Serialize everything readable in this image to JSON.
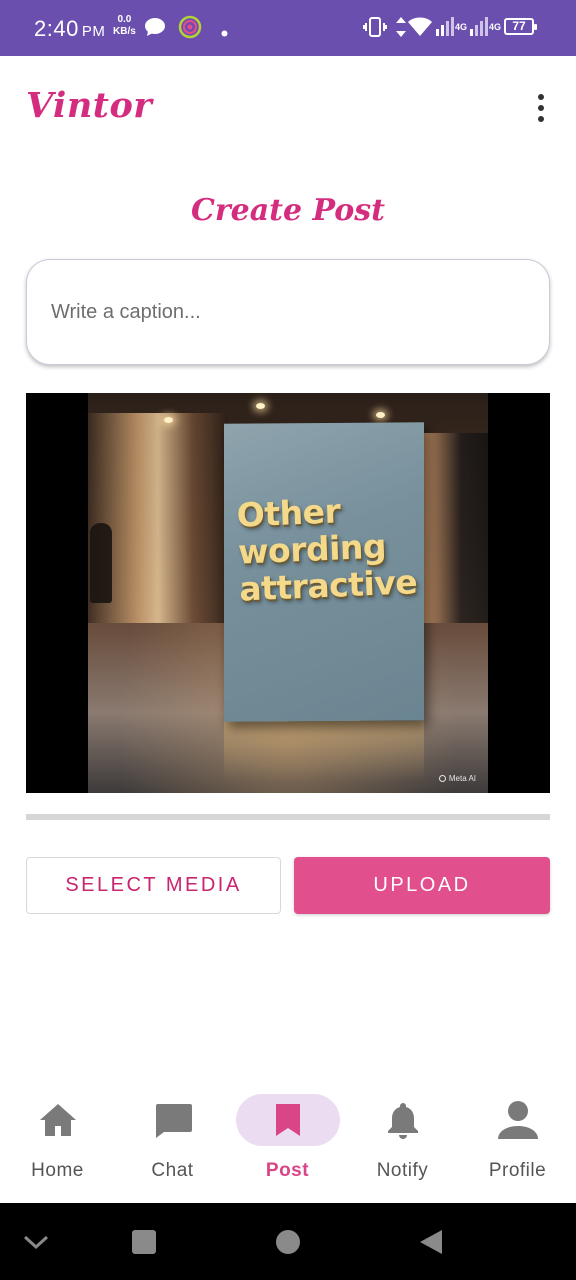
{
  "status_bar": {
    "time": "2:40",
    "ampm": "PM",
    "net_speed_value": "0.0",
    "net_speed_unit": "KB/s",
    "battery": "77",
    "signal_1": "4G",
    "signal_2": "4G",
    "icons": [
      "chat-bubble-icon",
      "record-icon",
      "dot-icon",
      "vibrate-icon",
      "data-arrows-icon",
      "wifi-icon",
      "signal-icon",
      "signal-icon",
      "battery-icon"
    ]
  },
  "app_bar": {
    "title": "Vintor",
    "menu_icon": "more-vert-icon"
  },
  "page": {
    "title": "Create Post"
  },
  "caption": {
    "placeholder": "Write a caption...",
    "value": ""
  },
  "media": {
    "sign_lines": [
      "Other",
      "wording",
      "attractive"
    ],
    "watermark": "Meta AI"
  },
  "upload_progress": 0,
  "actions": {
    "select_media_label": "SELECT MEDIA",
    "upload_label": "UPLOAD"
  },
  "bottom_nav": {
    "items": [
      {
        "label": "Home",
        "icon": "home-icon"
      },
      {
        "label": "Chat",
        "icon": "chat-icon"
      },
      {
        "label": "Post",
        "icon": "bookmark-icon",
        "active": true
      },
      {
        "label": "Notify",
        "icon": "bell-icon"
      },
      {
        "label": "Profile",
        "icon": "person-icon"
      }
    ]
  },
  "system_nav": [
    "chevron-down-icon",
    "recents-icon",
    "home-circle-icon",
    "back-icon"
  ],
  "colors": {
    "status_bar": "#6a4fae",
    "brand": "#d42c7f",
    "upload_button": "#e14f8d",
    "active_pill": "#ecdcf2",
    "nav_icon": "#7a7a7a"
  }
}
